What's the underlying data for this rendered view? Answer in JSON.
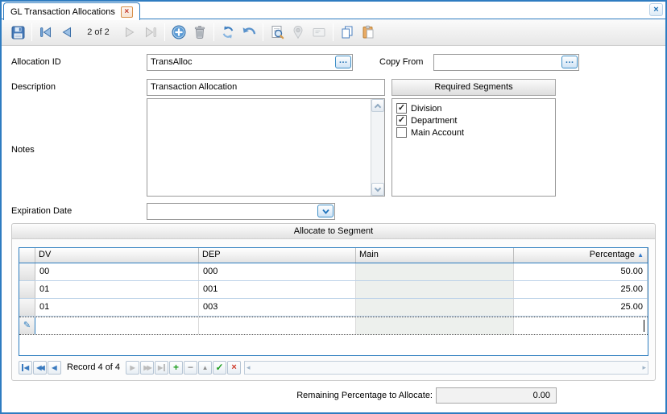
{
  "window": {
    "tab_title": "GL Transaction Allocations"
  },
  "toolbar": {
    "record_position": "2 of 2",
    "icon_names": [
      "save",
      "first-record",
      "previous-record",
      "next-record",
      "last-record",
      "add-record",
      "delete-record",
      "refresh",
      "undo",
      "preview",
      "attachment",
      "email",
      "copy",
      "paste"
    ]
  },
  "form": {
    "allocation_id": {
      "label": "Allocation ID",
      "value": "TransAlloc"
    },
    "copy_from": {
      "label": "Copy From",
      "value": ""
    },
    "description": {
      "label": "Description",
      "value": "Transaction Allocation"
    },
    "notes": {
      "label": "Notes",
      "value": ""
    },
    "expiration_date": {
      "label": "Expiration Date",
      "value": ""
    },
    "required_segments": {
      "header": "Required Segments",
      "items": [
        {
          "label": "Division",
          "checked": true,
          "mark": "✓"
        },
        {
          "label": "Department",
          "checked": true,
          "mark": "✓"
        },
        {
          "label": "Main Account",
          "checked": false,
          "mark": ""
        }
      ]
    }
  },
  "grid": {
    "group_title": "Allocate to Segment",
    "columns": {
      "dv": "DV",
      "dep": "DEP",
      "main": "Main",
      "percentage": "Percentage"
    },
    "sort_indicator": "▲",
    "rows": [
      {
        "dv": "00",
        "dep": "000",
        "main": "",
        "percentage": "50.00"
      },
      {
        "dv": "01",
        "dep": "001",
        "main": "",
        "percentage": "25.00"
      },
      {
        "dv": "01",
        "dep": "003",
        "main": "",
        "percentage": "25.00"
      }
    ],
    "new_row_editing": true,
    "navigator": {
      "label": "Record 4 of 4"
    }
  },
  "footer": {
    "remaining_label": "Remaining Percentage to Allocate:",
    "remaining_value": "0.00"
  },
  "icons": {
    "ellipsis": "…",
    "pencil": "✎",
    "close": "×",
    "nav_first": "◀",
    "nav_prev_page": "◀◀",
    "nav_prev": "◀",
    "nav_next": "▶",
    "nav_next_page": "▶▶",
    "nav_last": "▶",
    "nav_add": "+",
    "nav_delete": "−",
    "nav_edit": "▲",
    "nav_post": "✓",
    "nav_cancel": "×",
    "scroll_left": "◂",
    "scroll_right": "▸"
  },
  "colors": {
    "accent": "#2e7cc1",
    "grid_border": "#2d7dbf",
    "disabled_cell": "#edf0ed",
    "tab_close": "#c43b2b"
  }
}
